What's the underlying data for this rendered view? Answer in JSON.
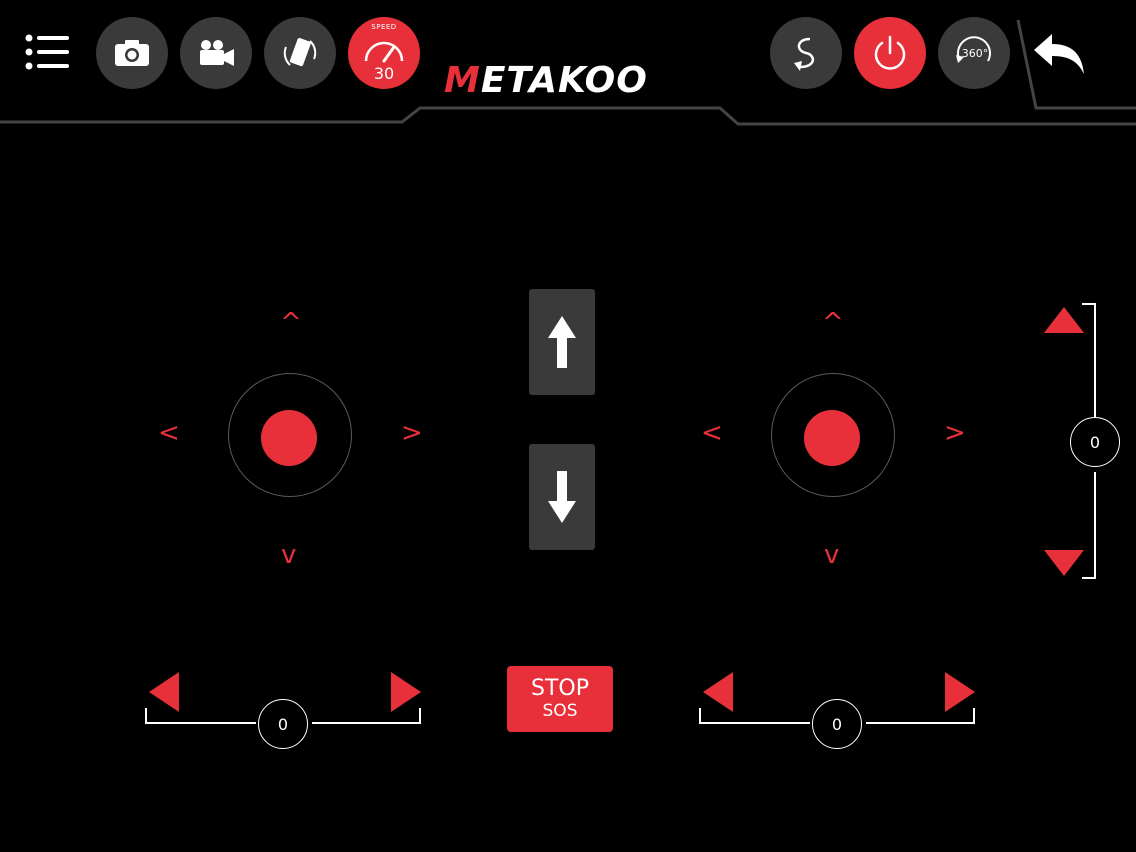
{
  "toolbar": {
    "speed_label": "SPEED",
    "speed_value": "30"
  },
  "logo": {
    "first_letter": "M",
    "rest": "ETAKOO"
  },
  "trims": {
    "left_horizontal": "0",
    "right_horizontal": "0",
    "right_vertical": "0"
  },
  "stop_button": {
    "line1": "STOP",
    "line2": "SOS"
  },
  "chevrons": {
    "up": "^",
    "down": "v",
    "left": "<",
    "right": ">"
  },
  "colors": {
    "accent": "#e8303a",
    "button_gray": "#3a3a3a",
    "background": "#000000"
  }
}
